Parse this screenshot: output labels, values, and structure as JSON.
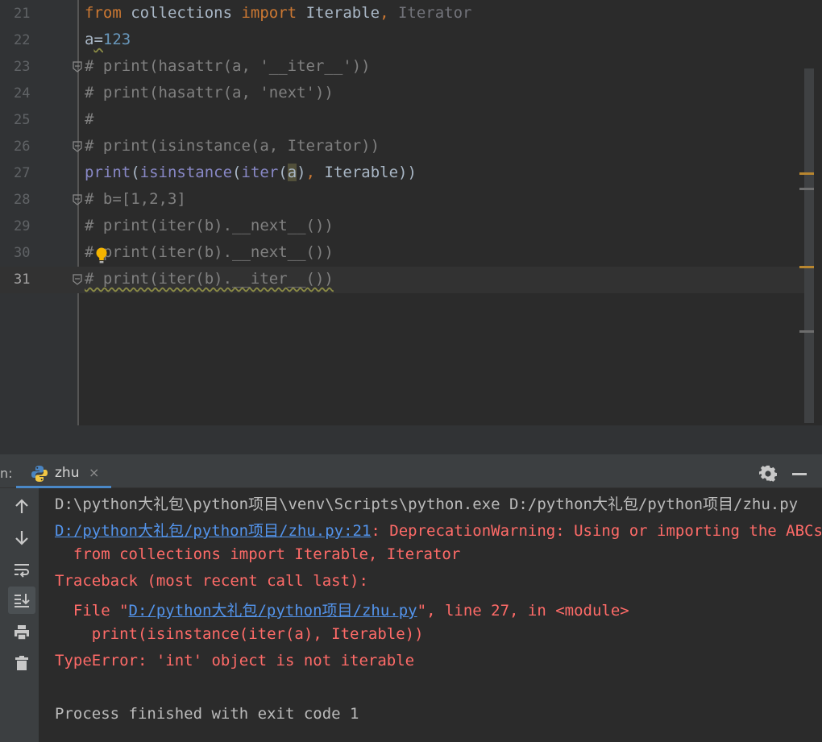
{
  "editor": {
    "lines": [
      {
        "num": "21",
        "segments": [
          {
            "t": "from",
            "c": "kw"
          },
          {
            "t": " collections ",
            "c": ""
          },
          {
            "t": "import",
            "c": "kw"
          },
          {
            "t": " Iterable",
            "c": ""
          },
          {
            "t": ",",
            "c": "kw"
          },
          {
            "t": " Iterator",
            "c": "dim"
          }
        ]
      },
      {
        "num": "22",
        "segments": [
          {
            "t": "a",
            "c": ""
          },
          {
            "t": "=",
            "c": "wavy"
          },
          {
            "t": "123",
            "c": "num"
          }
        ]
      },
      {
        "num": "23",
        "segments": [
          {
            "t": "# print(hasattr(a, '__iter__'))",
            "c": "cmt"
          }
        ],
        "fold": true
      },
      {
        "num": "24",
        "segments": [
          {
            "t": "# print(hasattr(a, 'next'))",
            "c": "cmt"
          }
        ]
      },
      {
        "num": "25",
        "segments": [
          {
            "t": "#",
            "c": "cmt"
          }
        ]
      },
      {
        "num": "26",
        "segments": [
          {
            "t": "# print(isinstance(a, Iterator))",
            "c": "cmt"
          }
        ],
        "fold": true
      },
      {
        "num": "27",
        "segments": [
          {
            "t": "print",
            "c": "builtin"
          },
          {
            "t": "(",
            "c": ""
          },
          {
            "t": "isinstance",
            "c": "builtin"
          },
          {
            "t": "(",
            "c": ""
          },
          {
            "t": "iter",
            "c": "builtin"
          },
          {
            "t": "(",
            "c": ""
          },
          {
            "t": "a",
            "c": "hl"
          },
          {
            "t": ")",
            "c": ""
          },
          {
            "t": ",",
            "c": "kw"
          },
          {
            "t": " Iterable))",
            "c": ""
          }
        ]
      },
      {
        "num": "28",
        "segments": [
          {
            "t": "# b=[1,2,3]",
            "c": "cmt"
          }
        ],
        "fold": true
      },
      {
        "num": "29",
        "segments": [
          {
            "t": "# print(iter(b).__next__())",
            "c": "cmt"
          }
        ]
      },
      {
        "num": "30",
        "segments": [
          {
            "t": "# print(iter(b).__next__())",
            "c": "cmt"
          }
        ],
        "bulb": true
      },
      {
        "num": "31",
        "segments": [
          {
            "t": "# print(iter(b).__iter__())",
            "c": "cmt wavy"
          }
        ],
        "fold": true,
        "current": true
      }
    ],
    "marker_color": "#b8862f",
    "marker_color_dim": "#6d6d6d"
  },
  "run_panel": {
    "prefix": "n:",
    "tab_label": "zhu",
    "tab_close": "×",
    "tools": [
      "up-arrow-icon",
      "down-arrow-icon",
      "soft-wrap-icon",
      "scroll-to-end-icon",
      "print-icon",
      "trash-icon"
    ],
    "console": [
      {
        "segments": [
          {
            "t": "D:\\python大礼包\\python项目\\venv\\Scripts\\python.exe D:/python大礼包/python项目/zhu.py",
            "c": "c-plain"
          }
        ]
      },
      {
        "segments": [
          {
            "t": "D:/python大礼包/python项目/zhu.py:21",
            "c": "c-link"
          },
          {
            "t": ": DeprecationWarning: Using or importing the ABCs from 'collections' instead of from 'collections.abc' is deprecated",
            "c": "c-err"
          }
        ]
      },
      {
        "segments": [
          {
            "t": "  from collections import Iterable, Iterator",
            "c": "c-err"
          }
        ]
      },
      {
        "segments": [
          {
            "t": "Traceback (most recent call last):",
            "c": "c-err"
          }
        ]
      },
      {
        "segments": [
          {
            "t": "  File \"",
            "c": "c-err"
          },
          {
            "t": "D:/python大礼包/python项目/zhu.py",
            "c": "c-link"
          },
          {
            "t": "\", line 27, in <module>",
            "c": "c-err"
          }
        ]
      },
      {
        "segments": [
          {
            "t": "    print(isinstance(iter(a), Iterable))",
            "c": "c-err"
          }
        ]
      },
      {
        "segments": [
          {
            "t": "TypeError: 'int' object is not iterable",
            "c": "c-err"
          }
        ]
      },
      {
        "segments": [
          {
            "t": "",
            "c": "c-plain"
          }
        ]
      },
      {
        "segments": [
          {
            "t": "Process finished with exit code 1",
            "c": "c-plain"
          }
        ]
      }
    ]
  }
}
